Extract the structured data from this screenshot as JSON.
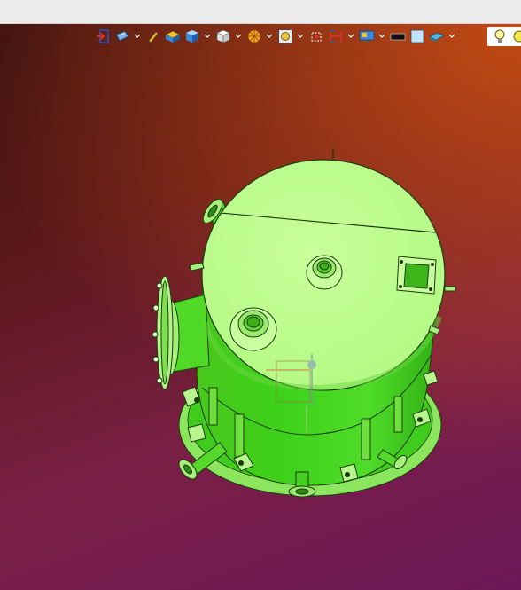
{
  "window": {
    "title_bar_text": ""
  },
  "toolbar": {
    "items": [
      {
        "icon": "exit-icon",
        "has_dropdown": false
      },
      {
        "icon": "render-style-icon",
        "has_dropdown": true
      },
      {
        "icon": "pencil-icon",
        "has_dropdown": false
      },
      {
        "icon": "layer-box-icon",
        "has_dropdown": false
      },
      {
        "icon": "cube-shaded-icon",
        "has_dropdown": true
      },
      {
        "icon": "cube-white-icon",
        "has_dropdown": true
      },
      {
        "icon": "section-disc-icon",
        "has_dropdown": true
      },
      {
        "icon": "zoom-fit-icon",
        "has_dropdown": true
      },
      {
        "icon": "snap-icon",
        "has_dropdown": false
      },
      {
        "icon": "measure-icon",
        "has_dropdown": true
      },
      {
        "icon": "display-monitor-icon",
        "has_dropdown": true
      },
      {
        "icon": "black-background-icon",
        "has_dropdown": false
      },
      {
        "icon": "light-background-icon",
        "has_dropdown": false
      },
      {
        "icon": "plane-icon",
        "has_dropdown": true
      },
      {
        "icon": "lightbulb-icon",
        "has_dropdown": false
      },
      {
        "icon": "light-sphere-icon",
        "has_dropdown": false
      }
    ]
  },
  "viewport": {
    "model": "pressure-vessel",
    "model_color": "#66e23a",
    "background_colors": [
      "#3a1010",
      "#c8501a",
      "#6c1858"
    ]
  }
}
